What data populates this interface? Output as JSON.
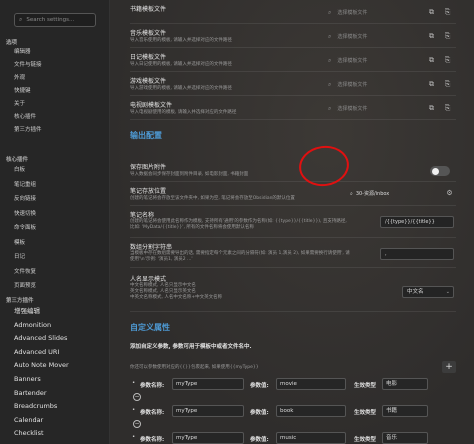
{
  "sidebar": {
    "search_placeholder": "Search settings...",
    "section_options": "选项",
    "options": [
      "编辑器",
      "文件与链接",
      "外观",
      "快捷键",
      "关于",
      "核心插件",
      "第三方插件"
    ],
    "section_core": "核心插件",
    "core": [
      "白板",
      "笔记重组",
      "反向链接",
      "快速切换",
      "命令面板",
      "模板",
      "日记",
      "文件恢复",
      "页面预览"
    ],
    "section_third": "第三方插件",
    "third": [
      "增强编辑",
      "Admonition",
      "Advanced Slides",
      "Advanced URI",
      "Auto Note Mover",
      "Banners",
      "Bartender",
      "Breadcrumbs",
      "Calendar",
      "Checklist"
    ]
  },
  "templates": [
    {
      "title": "书籍模板文件",
      "desc": "",
      "placeholder": "选择模板文件"
    },
    {
      "title": "音乐模板文件",
      "desc": "导入音乐使用的模板, 请输入并选择对应的文件路径",
      "placeholder": "选择模板文件"
    },
    {
      "title": "日记模板文件",
      "desc": "导入日记使用的模板, 请输入并选择对应的文件路径",
      "placeholder": "选择模板文件"
    },
    {
      "title": "游戏模板文件",
      "desc": "导入游戏使用的模板, 请输入并选择对应的文件路径",
      "placeholder": "选择模板文件"
    },
    {
      "title": "电视剧模板文件",
      "desc": "导入电视剧使用的模板, 请输入并选择对应的文件路径",
      "placeholder": "选择模板文件"
    }
  ],
  "output_section": "输出配置",
  "save_image": {
    "title": "保存图片附件",
    "desc": "导入数据会同步保存封面到附件目录, 如电影封面, 书籍封面"
  },
  "note_location": {
    "title": "笔记存放位置",
    "desc": "创建的笔记将会存放至该文件夹中, 如果为空, 笔记将会存放至Obsidian的默认位置",
    "value": "30-资源/inbox"
  },
  "note_name": {
    "title": "笔记名称",
    "desc": "创建的笔记将会使用此名称作为模板, 支持所有'通用'的参数作为名称(如: {{type}}/{{title}}), 且支持路径, 比如: 'MyData/{{title}}', 所有的文件名称将会使用默认名称",
    "value": "/{{type}}/{{title}}"
  },
  "separator": {
    "title": "数组分割字符串",
    "desc": "当模板中存在数组需要导出的话, 需要指定每个元素之间的分隔符(如: 演员 1,演员 2), 如果需要换行请使用', 请使用'\\n'示例: '演员1, 演员2 ...'",
    "value": ","
  },
  "person_mode": {
    "title": "人名显示模式",
    "desc": "中文名称模式, 人名只显示中文名\n英文名称模式, 人名只显示英文名\n中英文名称模式, 人名中文名称+中文英文名称",
    "value": "中文名"
  },
  "custom_section": "自定义属性",
  "custom_desc": "添加自定义参数, 参数可用于模板中或者文件名中.",
  "custom_sub": "你还可以参数使用对应的{{}}包裹起来, 如果使用{{myType}}",
  "params": [
    {
      "name_label": "参数名称:",
      "name": "myType",
      "value_label": "参数值:",
      "value": "movie",
      "type_label": "生效类型",
      "type": "电影"
    },
    {
      "name_label": "参数名称:",
      "name": "myType",
      "value_label": "参数值:",
      "value": "book",
      "type_label": "生效类型",
      "type": "书籍"
    },
    {
      "name_label": "参数名称:",
      "name": "myType",
      "value_label": "参数值:",
      "value": "music",
      "type_label": "生效类型",
      "type": "音乐"
    }
  ],
  "colors": {
    "accent": "#4e9bd6",
    "highlight": "#e01010"
  }
}
